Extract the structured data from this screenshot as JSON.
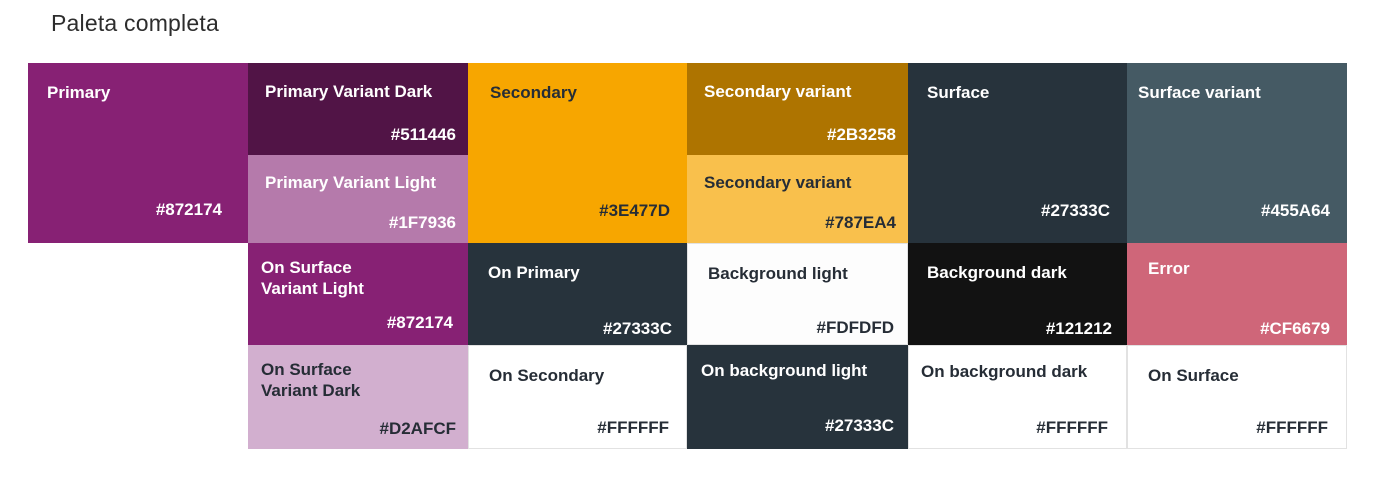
{
  "title": "Paleta completa",
  "swatches": [
    {
      "id": "primary",
      "name": "Primary",
      "hex": "#872174",
      "bg": "#872174"
    },
    {
      "id": "primary-variant-dark",
      "name": "Primary Variant Dark",
      "hex": "#511446",
      "bg": "#511446"
    },
    {
      "id": "primary-variant-light",
      "name": "Primary Variant Light",
      "hex": "#1F7936",
      "bg": "#B57AAB"
    },
    {
      "id": "secondary",
      "name": "Secondary",
      "hex": "#3E477D",
      "bg": "#F7A600"
    },
    {
      "id": "secondary-variant-dark",
      "name": "Secondary variant",
      "hex": "#2B3258",
      "bg": "#AE7400"
    },
    {
      "id": "secondary-variant-light",
      "name": "Secondary variant",
      "hex": "#787EA4",
      "bg": "#F9C04C"
    },
    {
      "id": "surface",
      "name": "Surface",
      "hex": "#27333C",
      "bg": "#27333C"
    },
    {
      "id": "surface-variant",
      "name": "Surface variant",
      "hex": "#455A64",
      "bg": "#455A64"
    },
    {
      "id": "on-surface-variant-light",
      "name": "On Surface\nVariant Light",
      "hex": "#872174",
      "bg": "#872174"
    },
    {
      "id": "on-primary",
      "name": "On Primary",
      "hex": "#27333C",
      "bg": "#27333C"
    },
    {
      "id": "background-light",
      "name": "Background light",
      "hex": "#FDFDFD",
      "bg": "#FDFDFD"
    },
    {
      "id": "background-dark",
      "name": "Background dark",
      "hex": "#121212",
      "bg": "#121212"
    },
    {
      "id": "error",
      "name": "Error",
      "hex": "#CF6679",
      "bg": "#CF6679"
    },
    {
      "id": "on-surface-variant-dark",
      "name": "On Surface\nVariant Dark",
      "hex": "#D2AFCF",
      "bg": "#D2AFCF"
    },
    {
      "id": "on-secondary",
      "name": "On Secondary",
      "hex": "#FFFFFF",
      "bg": "#FFFFFF"
    },
    {
      "id": "on-background-light",
      "name": "On background light",
      "hex": "#27333C",
      "bg": "#27333C"
    },
    {
      "id": "on-background-dark",
      "name": "On background dark",
      "hex": "#FFFFFF",
      "bg": "#FFFFFF"
    },
    {
      "id": "on-surface",
      "name": "On Surface",
      "hex": "#FFFFFF",
      "bg": "#FFFFFF"
    }
  ]
}
